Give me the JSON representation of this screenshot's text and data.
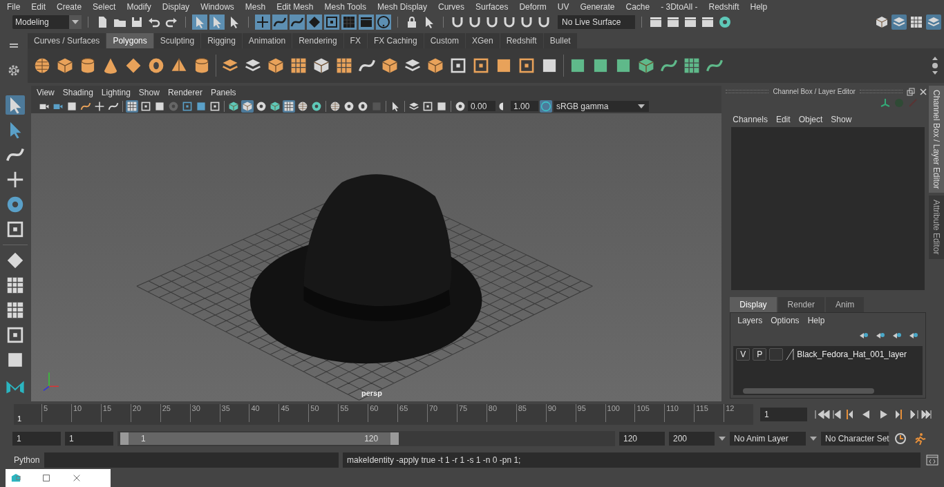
{
  "menu_bar": [
    "File",
    "Edit",
    "Create",
    "Select",
    "Modify",
    "Display",
    "Windows",
    "Mesh",
    "Edit Mesh",
    "Mesh Tools",
    "Mesh Display",
    "Curves",
    "Surfaces",
    "Deform",
    "UV",
    "Generate",
    "Cache",
    "- 3DtoAll -",
    "Redshift",
    "Help"
  ],
  "status_line": {
    "menu_set": "Modeling",
    "live_surface": "No Live Surface"
  },
  "shelf": {
    "tabs": [
      {
        "label": "Curves / Surfaces",
        "selected": false
      },
      {
        "label": "Polygons",
        "selected": true
      },
      {
        "label": "Sculpting",
        "selected": false
      },
      {
        "label": "Rigging",
        "selected": false
      },
      {
        "label": "Animation",
        "selected": false
      },
      {
        "label": "Rendering",
        "selected": false
      },
      {
        "label": "FX",
        "selected": false
      },
      {
        "label": "FX Caching",
        "selected": false
      },
      {
        "label": "Custom",
        "selected": false
      },
      {
        "label": "XGen",
        "selected": false
      },
      {
        "label": "Redshift",
        "selected": false
      },
      {
        "label": "Bullet",
        "selected": false
      }
    ]
  },
  "viewport": {
    "menu": [
      "View",
      "Shading",
      "Lighting",
      "Show",
      "Renderer",
      "Panels"
    ],
    "exposure": "0.00",
    "gamma": "1.00",
    "color_space": "sRGB gamma",
    "camera": "persp"
  },
  "channel_box": {
    "title": "Channel Box / Layer Editor",
    "menu": [
      "Channels",
      "Edit",
      "Object",
      "Show"
    ]
  },
  "layer_editor": {
    "tabs": [
      {
        "label": "Display",
        "selected": true
      },
      {
        "label": "Render",
        "selected": false
      },
      {
        "label": "Anim",
        "selected": false
      }
    ],
    "menu": [
      "Layers",
      "Options",
      "Help"
    ],
    "layers": [
      {
        "visible": "V",
        "playback": "P",
        "name": "Black_Fedora_Hat_001_layer"
      }
    ]
  },
  "side_tabs": [
    {
      "label": "Channel Box / Layer Editor",
      "selected": true
    },
    {
      "label": "Attribute Editor",
      "selected": false
    }
  ],
  "time_slider": {
    "start": "1",
    "ticks": [
      "5",
      "10",
      "15",
      "20",
      "25",
      "30",
      "35",
      "40",
      "45",
      "50",
      "55",
      "60",
      "65",
      "70",
      "75",
      "80",
      "85",
      "90",
      "95",
      "100",
      "105",
      "110",
      "115",
      "12"
    ],
    "current_frame": "1"
  },
  "range_slider": {
    "level": 0.56,
    "start": "1",
    "playback_start": "1",
    "range_start": "1",
    "range_end": "120",
    "playback_end": "120",
    "end": "200",
    "anim_layer": "No Anim Layer",
    "character_set": "No Character Set"
  },
  "command_line": {
    "language": "Python",
    "result": "makeIdentity -apply true -t 1 -r 1 -s 1 -n 0 -pn 1;"
  }
}
